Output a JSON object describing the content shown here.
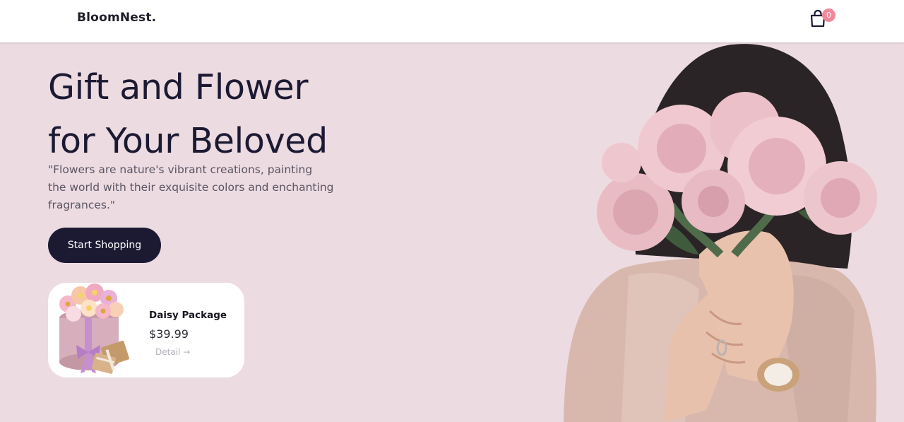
{
  "header": {
    "brand": "BloomNest.",
    "cart_count": "0",
    "cart_icon": "shopping-bag-icon"
  },
  "hero": {
    "title_line1": "Gift and Flower",
    "title_line2": "for Your Beloved",
    "quote_line1": "\"Flowers are nature's vibrant creations, painting",
    "quote_line2": "the world with their exquisite colors and enchanting",
    "quote_line3": "fragrances.\"",
    "cta_label": "Start Shopping"
  },
  "featured_product": {
    "name": "Daisy Package",
    "price": "$39.99",
    "detail_label": "Detail →",
    "image_icon": "flower-box-gift-image"
  },
  "colors": {
    "hero_background": "#ecdbe1",
    "primary_dark": "#1c1a33",
    "badge": "#f0899b",
    "card_background": "#ffffff"
  }
}
